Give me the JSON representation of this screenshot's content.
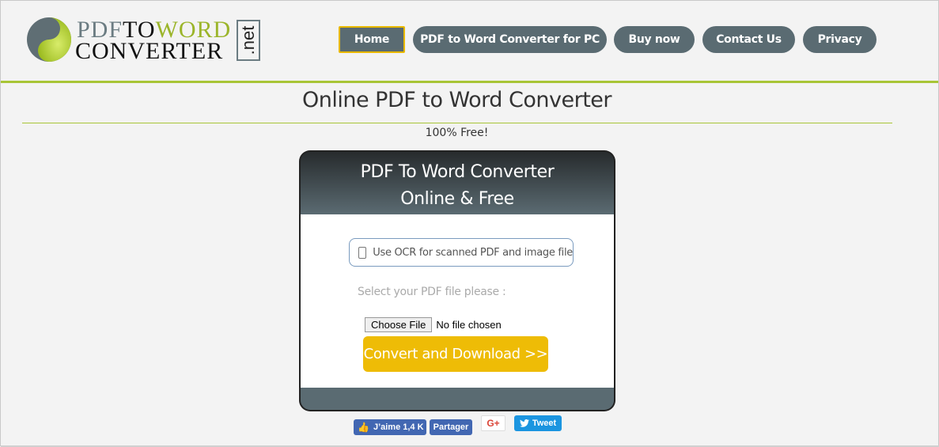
{
  "logo": {
    "line1_a": "PDF",
    "line1_b": "TO",
    "line1_c": "WORD",
    "line2": "CONVERTER",
    "badge": ".net"
  },
  "nav": {
    "items": [
      {
        "label": "Home",
        "active": true
      },
      {
        "label": "PDF to Word Converter for PC",
        "active": false
      },
      {
        "label": "Buy now",
        "active": false
      },
      {
        "label": "Contact Us",
        "active": false
      },
      {
        "label": "Privacy",
        "active": false
      }
    ]
  },
  "page": {
    "title": "Online PDF to Word Converter",
    "subtitle": "100% Free!"
  },
  "converter": {
    "title_line1": "PDF To Word Converter",
    "title_line2": "Online & Free",
    "ocr_label": "Use OCR for scanned PDF and image file",
    "ocr_checked": false,
    "select_label": "Select your PDF file please :",
    "choose_file_label": "Choose File",
    "file_status": "No file chosen",
    "convert_label": "Convert and Download >>"
  },
  "social": {
    "fb_like_label": "J’aime 1,4 K",
    "fb_share_label": "Partager",
    "gplus_label": "G+",
    "tweet_label": "Tweet"
  },
  "colors": {
    "accent_green": "#a8c536",
    "nav_bg": "#5a6b72",
    "active_border": "#e8b800",
    "convert_button": "#eebc06",
    "facebook": "#4267b2",
    "twitter": "#1b95e0"
  }
}
